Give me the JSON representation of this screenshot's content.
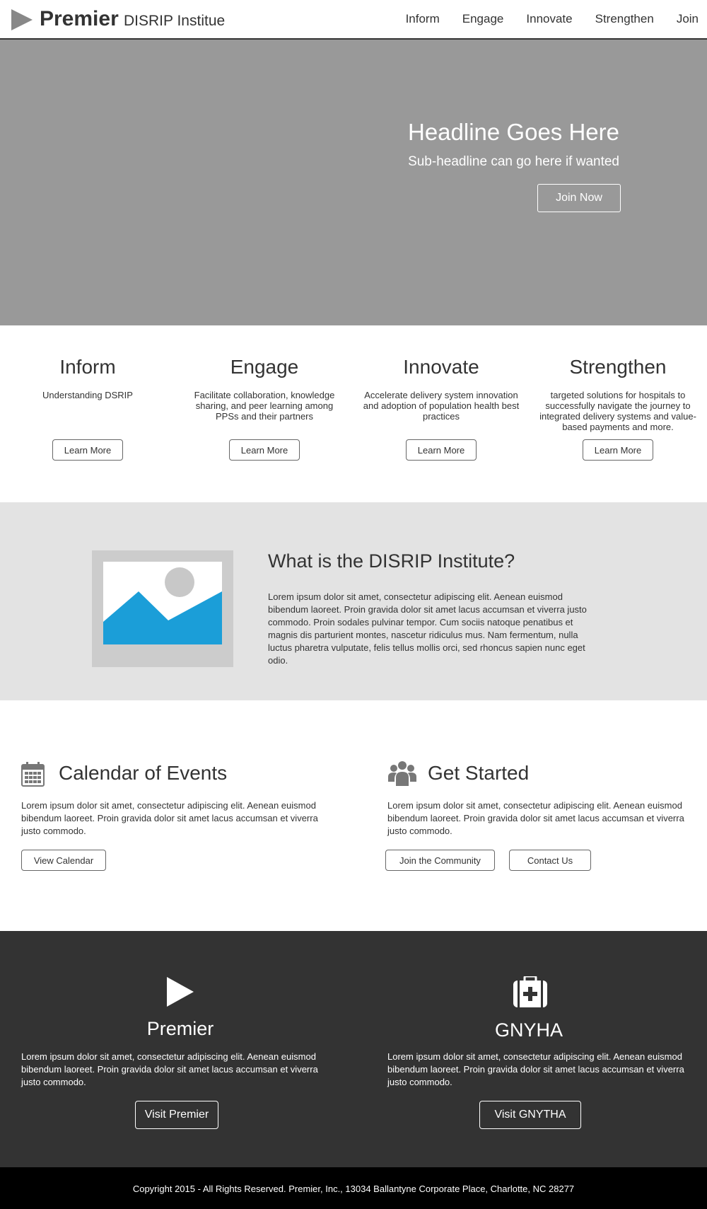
{
  "header": {
    "brand": "Premier",
    "subtitle": "DISRIP Institue",
    "nav": [
      "Inform",
      "Engage",
      "Innovate",
      "Strengthen",
      "Join"
    ]
  },
  "hero": {
    "headline": "Headline Goes Here",
    "subheadline": "Sub-headline can go here if wanted",
    "button": "Join Now",
    "background_color": "#999999"
  },
  "features": [
    {
      "title": "Inform",
      "text": "Understanding DSRIP",
      "button": "Learn More"
    },
    {
      "title": "Engage",
      "text": "Facilitate collaboration, knowledge sharing, and peer learning among PPSs and their partners",
      "button": "Learn More"
    },
    {
      "title": "Innovate",
      "text": "Accelerate delivery system innovation and adoption of population health best practices",
      "button": "Learn More"
    },
    {
      "title": "Strengthen",
      "text": "targeted solutions for hospitals to successfully navigate the journey to integrated delivery systems and value-based payments and more.",
      "button": "Learn More"
    }
  ],
  "about": {
    "image_icon": "image-placeholder-icon",
    "title": "What is the DISRIP Institute?",
    "text": "Lorem ipsum dolor sit amet, consectetur adipiscing elit. Aenean euismod bibendum laoreet. Proin gravida dolor sit amet lacus accumsan et viverra justo commodo. Proin sodales pulvinar tempor. Cum sociis natoque penatibus et magnis dis parturient montes, nascetur ridiculus mus. Nam fermentum, nulla luctus pharetra vulputate, felis tellus mollis orci, sed rhoncus sapien nunc eget odio.",
    "accent_color": "#1b9ed8"
  },
  "calendar": {
    "icon": "calendar-icon",
    "title": "Calendar of Events",
    "text": "Lorem ipsum dolor sit amet, consectetur adipiscing elit. Aenean euismod bibendum laoreet. Proin gravida dolor sit amet lacus accumsan et viverra justo commodo.",
    "button": "View Calendar"
  },
  "get_started": {
    "icon": "users-icon",
    "title": "Get Started",
    "text": "Lorem ipsum dolor sit amet, consectetur adipiscing elit. Aenean euismod bibendum laoreet. Proin gravida dolor sit amet lacus accumsan et viverra justo commodo.",
    "button_join": "Join the Community",
    "button_contact": "Contact Us"
  },
  "partners": [
    {
      "icon": "play-icon",
      "title": "Premier",
      "text": "Lorem ipsum dolor sit amet, consectetur adipiscing elit. Aenean euismod bibendum laoreet. Proin gravida dolor sit amet lacus accumsan et viverra justo commodo.",
      "button": "Visit Premier"
    },
    {
      "icon": "medical-kit-icon",
      "title": "GNYHA",
      "text": "Lorem ipsum dolor sit amet, consectetur adipiscing elit. Aenean euismod bibendum laoreet. Proin gravida dolor sit amet lacus accumsan et viverra justo commodo.",
      "button": "Visit GNYTHA"
    }
  ],
  "footer": {
    "copyright": "Copyright 2015 - All Rights Reserved. Premier, Inc., 13034 Ballantyne Corporate Place, Charlotte, NC 28277"
  }
}
